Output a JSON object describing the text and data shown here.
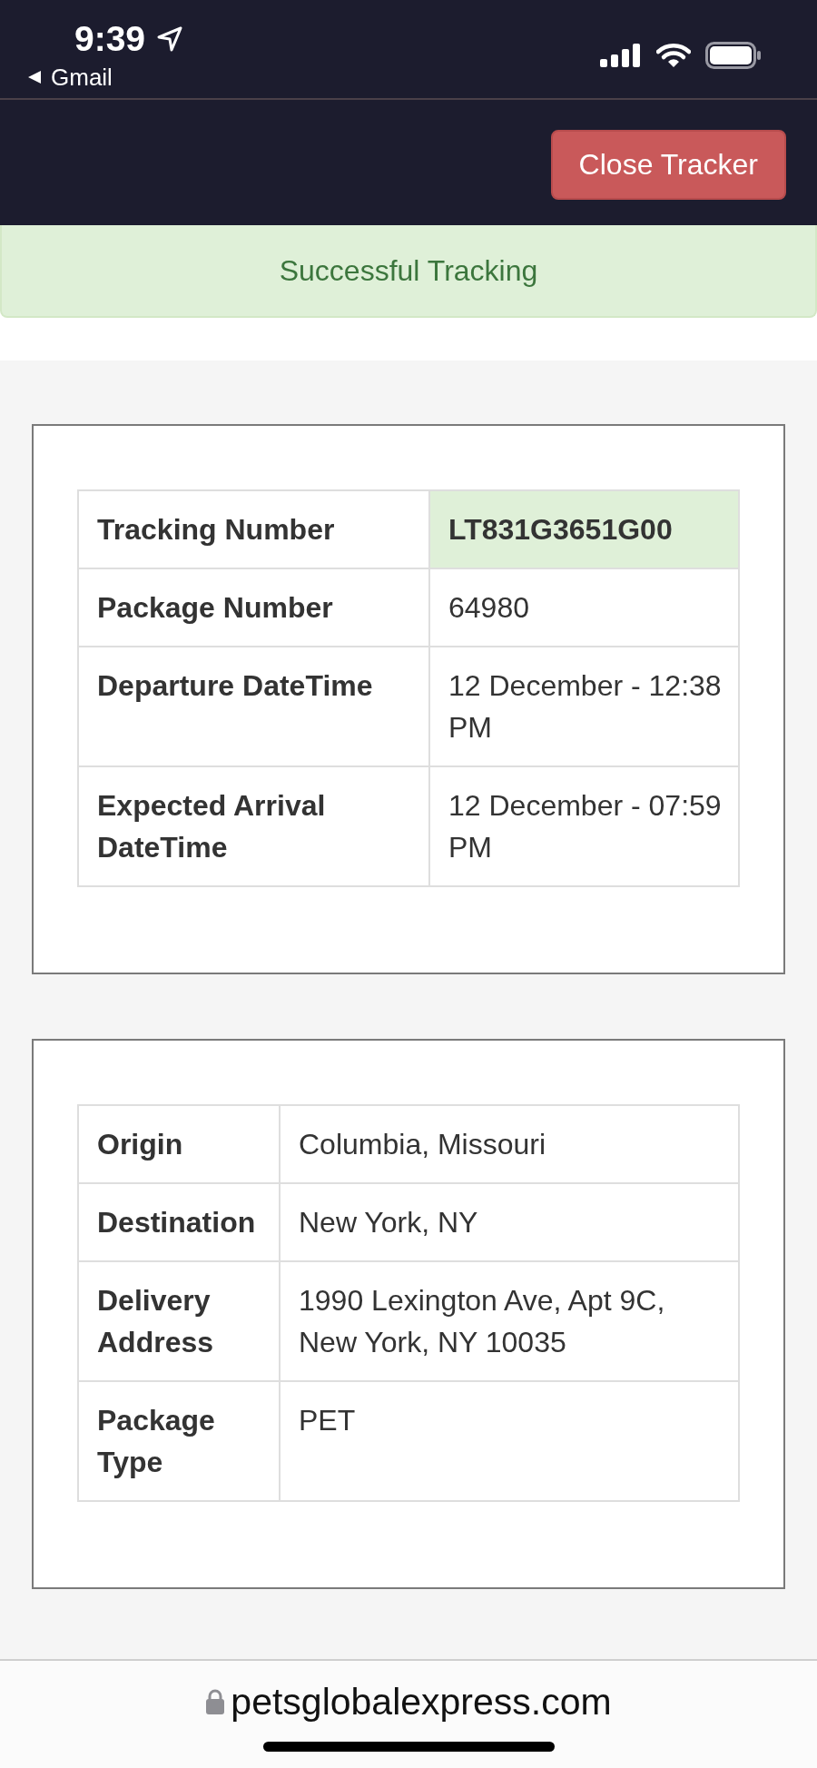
{
  "status_bar": {
    "time": "9:39",
    "back_link": "Gmail"
  },
  "header": {
    "button": "Close Tracker"
  },
  "alert": {
    "text": "Successful Tracking"
  },
  "cards": [
    {
      "rows": [
        {
          "label": "Tracking Number",
          "value": "LT831G3651G00",
          "highlighted": true
        },
        {
          "label": "Package Number",
          "value": "64980",
          "highlighted": false
        },
        {
          "label": "Departure DateTime",
          "value": "12 December - 12:38 PM",
          "highlighted": false
        },
        {
          "label": "Expected Arrival DateTime",
          "value": "12 December - 07:59 PM",
          "highlighted": false
        }
      ]
    },
    {
      "rows": [
        {
          "label": "Origin",
          "value": "Columbia, Missouri",
          "highlighted": false
        },
        {
          "label": "Destination",
          "value": "New York, NY",
          "highlighted": false
        },
        {
          "label": "Delivery Address",
          "value": "1990 Lexington Ave, Apt 9C, New York, NY 10035",
          "highlighted": false
        },
        {
          "label": "Package Type",
          "value": "PET",
          "highlighted": false
        }
      ]
    }
  ],
  "address_bar": {
    "url": "petsglobalexpress.com"
  }
}
